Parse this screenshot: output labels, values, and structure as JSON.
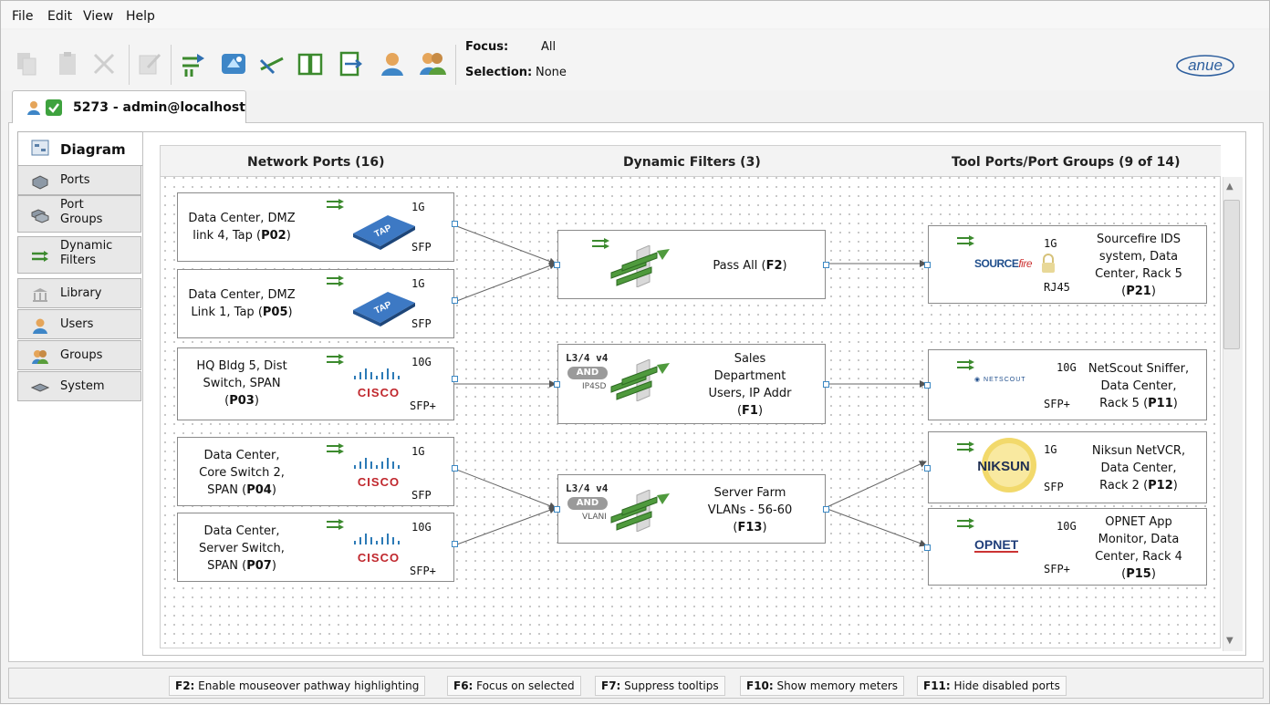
{
  "menu": {
    "file": "File",
    "edit": "Edit",
    "view": "View",
    "help": "Help"
  },
  "toolbar": {
    "focus_label": "Focus:",
    "focus_value": "All",
    "selection_label": "Selection:",
    "selection_value": "None",
    "buttons": [
      "copy-icon",
      "paste-icon",
      "delete-icon",
      "edit-icon",
      "filter-connect-icon",
      "port-map-icon",
      "disconnect-icon",
      "book-icon",
      "export-icon",
      "user-icon",
      "users-group-icon"
    ]
  },
  "brand": {
    "logo": "anue"
  },
  "session": {
    "tab_label": "5273 - admin@localhost",
    "status": "connected"
  },
  "sidebar": {
    "items": [
      {
        "label": "Diagram",
        "icon": "diagram-icon"
      },
      {
        "label": "Ports",
        "icon": "ports-icon"
      },
      {
        "label": "Port\nGroups",
        "icon": "port-groups-icon"
      },
      {
        "label": "Dynamic\nFilters",
        "icon": "dynamic-filters-icon"
      },
      {
        "label": "Library",
        "icon": "library-icon"
      },
      {
        "label": "Users",
        "icon": "users-icon"
      },
      {
        "label": "Groups",
        "icon": "groups-icon"
      },
      {
        "label": "System",
        "icon": "system-icon"
      }
    ]
  },
  "columns": {
    "network": "Network Ports (16)",
    "filters": "Dynamic Filters (3)",
    "tools": "Tool Ports/Port Groups (9 of 14)"
  },
  "network_ports": [
    {
      "name1": "Data Center, DMZ",
      "name2": "link 4, Tap (",
      "id": "P02",
      "suffix": ")",
      "speed": "1G",
      "conn": "SFP",
      "device": "TAP"
    },
    {
      "name1": "Data Center, DMZ",
      "name2": "Link 1, Tap (",
      "id": "P05",
      "suffix": ")",
      "speed": "1G",
      "conn": "SFP",
      "device": "TAP"
    },
    {
      "name1": "HQ Bldg 5, Dist",
      "name2": "Switch, SPAN",
      "name3": "(",
      "id": "P03",
      "suffix": ")",
      "speed": "10G",
      "conn": "SFP+",
      "device": "CISCO"
    },
    {
      "name1": "Data Center,",
      "name2": "Core Switch 2,",
      "name3": "SPAN (",
      "id": "P04",
      "suffix": ")",
      "speed": "1G",
      "conn": "SFP",
      "device": "CISCO"
    },
    {
      "name1": "Data Center,",
      "name2": "Server Switch,",
      "name3": "SPAN (",
      "id": "P07",
      "suffix": ")",
      "speed": "10G",
      "conn": "SFP+",
      "device": "CISCO"
    }
  ],
  "filters": [
    {
      "name1": "Pass All (",
      "id": "F2",
      "suffix": ")",
      "tag": "",
      "and": "",
      "sub": ""
    },
    {
      "name1": "Sales",
      "name2": "Department",
      "name3": "Users, IP Addr",
      "name4": "(",
      "id": "F1",
      "suffix": ")",
      "tag": "L3/4 v4",
      "and": "AND",
      "sub": "IP4SD"
    },
    {
      "name1": "Server Farm",
      "name2": "VLANs - 56-60",
      "name3": "(",
      "id": "F13",
      "suffix": ")",
      "tag": "L3/4 v4",
      "and": "AND",
      "sub": "VLANI"
    }
  ],
  "tool_ports": [
    {
      "name1": "Sourcefire IDS",
      "name2": "system, Data",
      "name3": "Center, Rack 5",
      "name4": "(",
      "id": "P21",
      "suffix": ")",
      "speed": "1G",
      "conn": "RJ45",
      "logo": "SOURCEfire"
    },
    {
      "name1": "NetScout Sniffer,",
      "name2": "Data Center,",
      "name3": "Rack 5 (",
      "id": "P11",
      "suffix": ")",
      "speed": "10G",
      "conn": "SFP+",
      "logo": "NETSCOUT"
    },
    {
      "name1": "Niksun NetVCR,",
      "name2": "Data Center,",
      "name3": "Rack 2 (",
      "id": "P12",
      "suffix": ")",
      "speed": "1G",
      "conn": "SFP",
      "logo": "NIKSUN"
    },
    {
      "name1": "OPNET App",
      "name2": "Monitor, Data",
      "name3": "Center, Rack 4",
      "name4": "(",
      "id": "P15",
      "suffix": ")",
      "speed": "10G",
      "conn": "SFP+",
      "logo": "OPNET"
    }
  ],
  "status_hints": [
    {
      "key": "F2:",
      "text": " Enable mouseover pathway highlighting"
    },
    {
      "key": "F6:",
      "text": " Focus on selected"
    },
    {
      "key": "F7:",
      "text": " Suppress tooltips"
    },
    {
      "key": "F10:",
      "text": " Show memory meters"
    },
    {
      "key": "F11:",
      "text": " Hide disabled ports"
    }
  ]
}
